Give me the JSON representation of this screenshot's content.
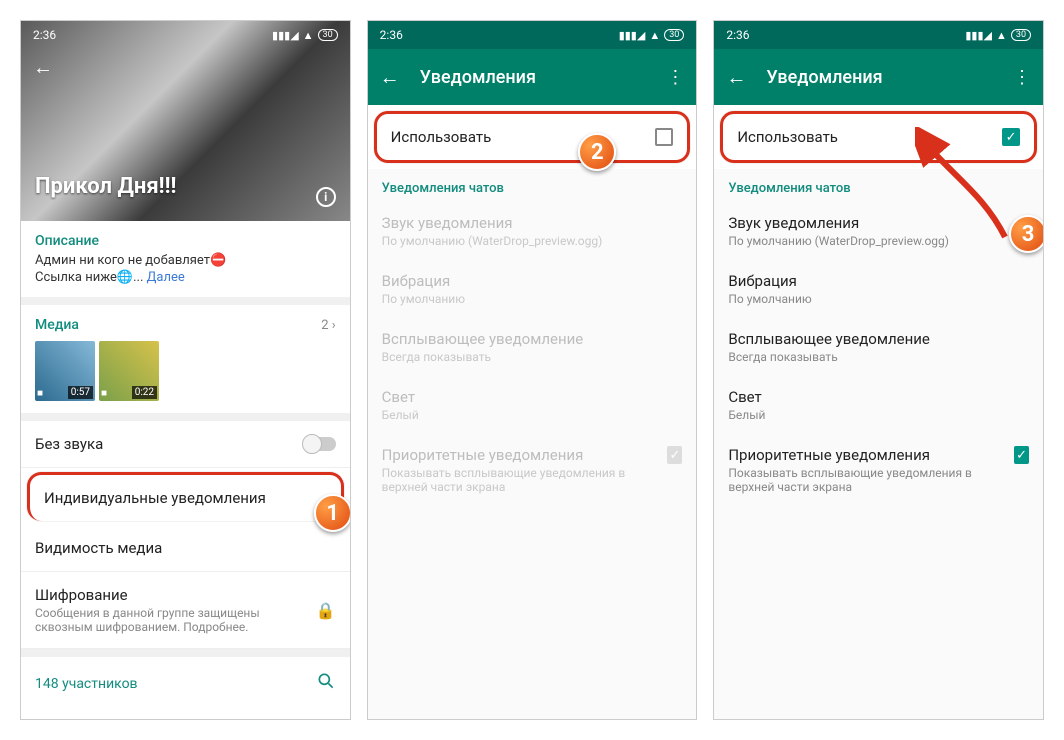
{
  "status": {
    "time": "2:36",
    "battery": "30"
  },
  "screen1": {
    "group_title": "Прикол Дня!!!",
    "description_label": "Описание",
    "admin_line": "Админ ни кого не добавляет⛔",
    "link_line_prefix": "Ссылка ниже🌐... ",
    "more": "Далее",
    "media_label": "Медиа",
    "media_count": "2 ›",
    "thumb1_duration": "0:57",
    "thumb2_duration": "0:22",
    "mute_label": "Без звука",
    "custom_notif_label": "Индивидуальные уведомления",
    "media_visibility_label": "Видимость медиа",
    "encryption_label": "Шифрование",
    "encryption_sub": "Сообщения в данной группе защищены сквозным шифрованием. Подробнее.",
    "participants": "148 участников"
  },
  "notif": {
    "title": "Уведомления",
    "use_label": "Использовать",
    "section_label": "Уведомления чатов",
    "sound_title": "Звук уведомления",
    "sound_sub": "По умолчанию (WaterDrop_preview.ogg)",
    "vibration_title": "Вибрация",
    "vibration_sub": "По умолчанию",
    "popup_title": "Всплывающее уведомление",
    "popup_sub": "Всегда показывать",
    "light_title": "Свет",
    "light_sub": "Белый",
    "priority_title": "Приоритетные уведомления",
    "priority_sub": "Показывать всплывающие уведомления в верхней части экрана"
  },
  "badges": {
    "one": "1",
    "two": "2",
    "three": "3"
  }
}
